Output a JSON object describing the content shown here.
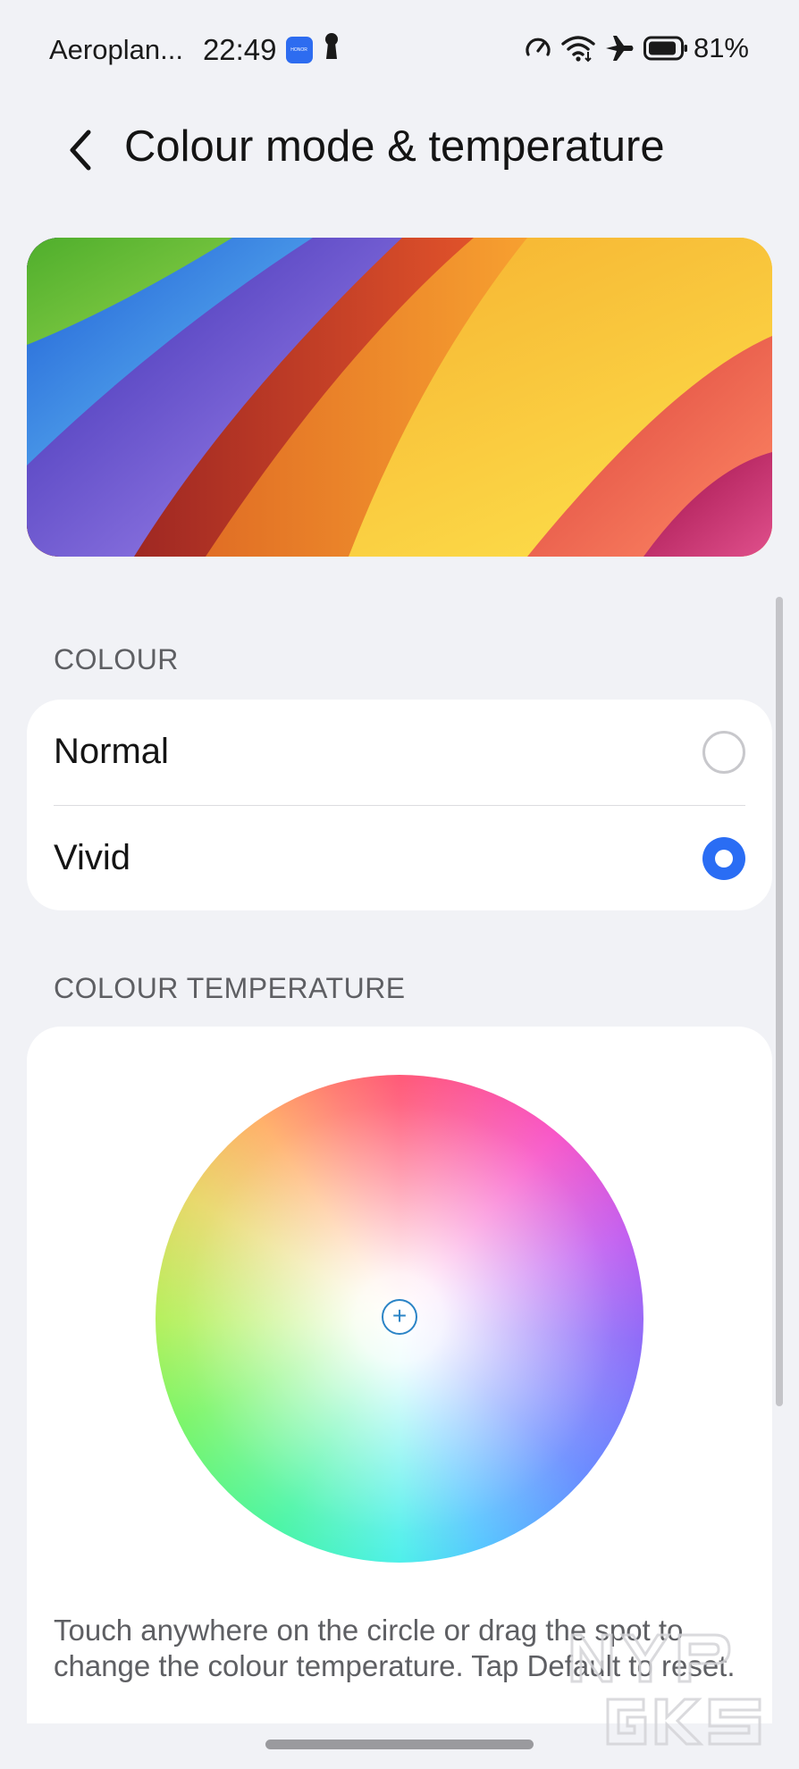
{
  "status_bar": {
    "carrier": "Aeroplan...",
    "time": "22:49",
    "badge": "HONOR",
    "battery": "81%",
    "icons": [
      "honor-app-icon",
      "keyhole-icon",
      "speed-meter-icon",
      "wifi-icon",
      "airplane-icon",
      "battery-icon"
    ]
  },
  "header": {
    "title": "Colour mode & temperature",
    "back_icon": "chevron-left-icon"
  },
  "colour_section": {
    "title": "COLOUR",
    "options": [
      {
        "label": "Normal",
        "selected": false
      },
      {
        "label": "Vivid",
        "selected": true
      }
    ]
  },
  "temperature_section": {
    "title": "COLOUR TEMPERATURE",
    "handle_glyph": "+",
    "helper": "Touch anywhere on the circle or drag the spot to change the colour temperature. Tap Default to reset."
  },
  "colors": {
    "accent": "#2a6df4",
    "background": "#f1f2f6",
    "card": "#ffffff",
    "secondary_text": "#5e5f63"
  }
}
